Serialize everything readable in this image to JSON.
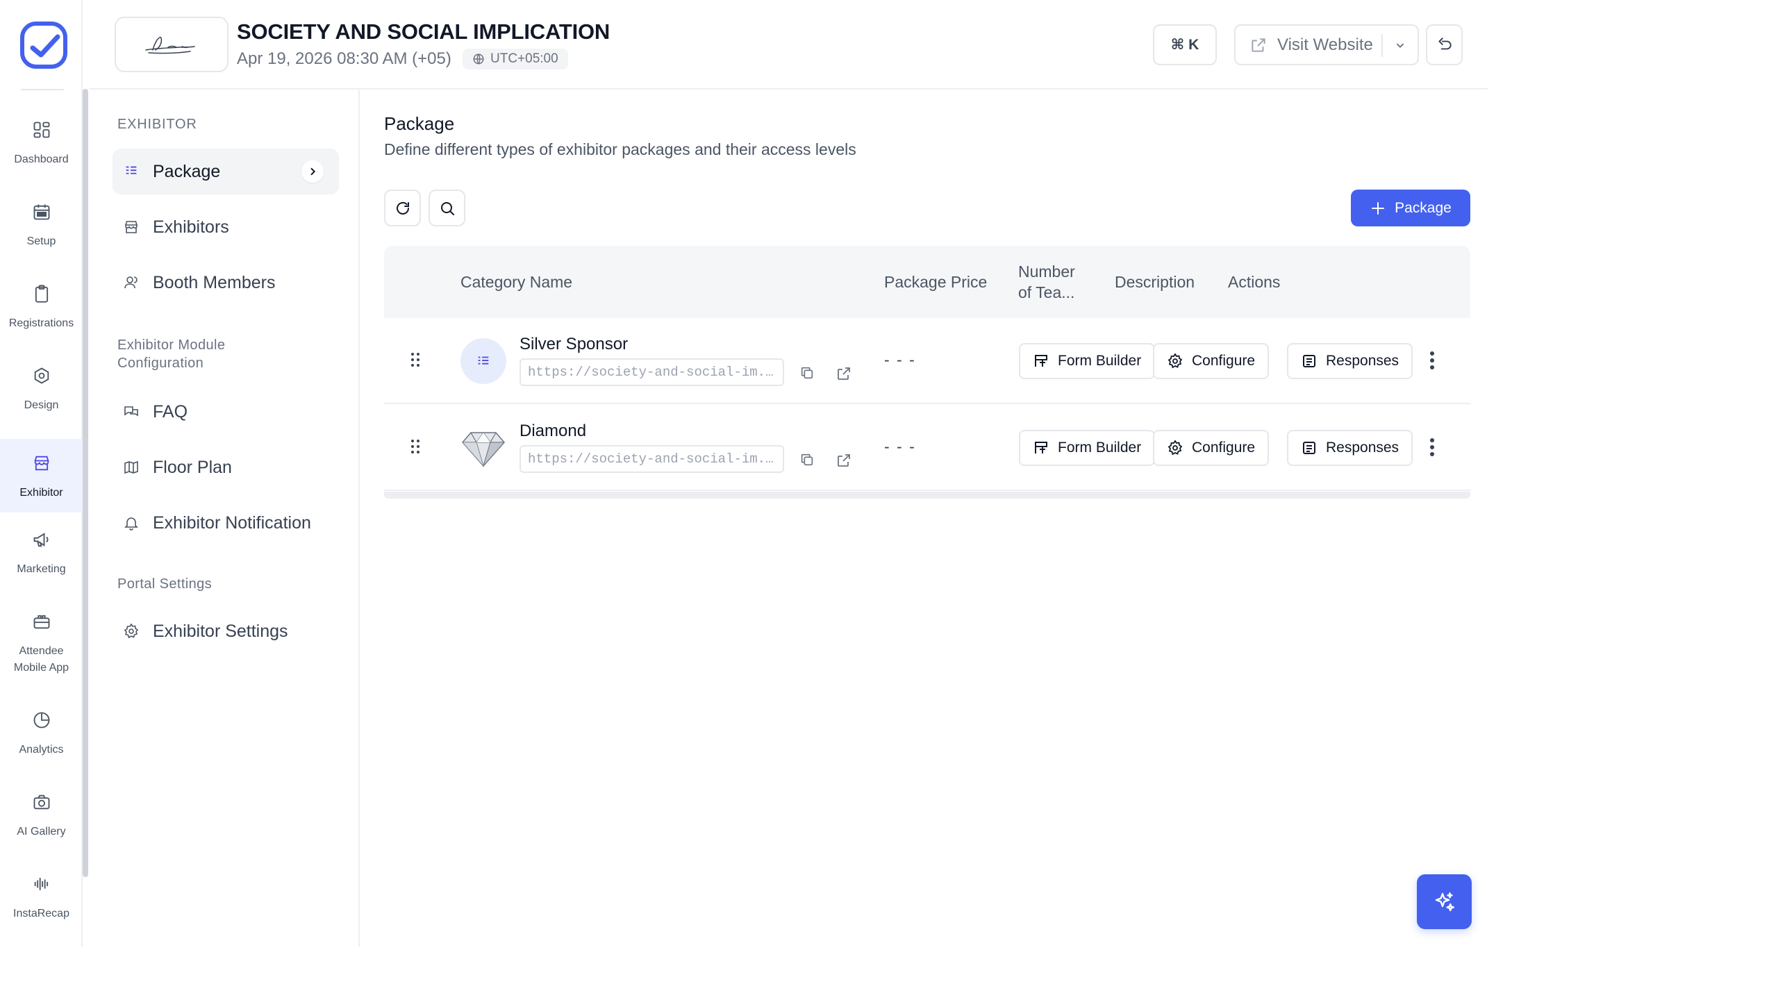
{
  "rail": {
    "items": [
      {
        "label": "Dashboard",
        "icon": "dashboard-icon"
      },
      {
        "label": "Setup",
        "icon": "calendar-icon"
      },
      {
        "label": "Registrations",
        "icon": "clipboard-icon"
      },
      {
        "label": "Design",
        "icon": "design-icon"
      },
      {
        "label": "Exhibitor",
        "icon": "store-icon"
      },
      {
        "label": "Marketing",
        "icon": "megaphone-icon"
      },
      {
        "label": "Attendee Mobile App",
        "icon": "mobile-app-icon"
      },
      {
        "label": "Analytics",
        "icon": "pie-chart-icon"
      },
      {
        "label": "AI Gallery",
        "icon": "camera-icon"
      },
      {
        "label": "InstaRecap",
        "icon": "soundwave-icon"
      }
    ],
    "active": "Exhibitor"
  },
  "header": {
    "title": "SOCIETY AND SOCIAL IMPLICATION",
    "datetime": "Apr 19, 2026 08:30 AM (+05)",
    "timezone": "UTC+05:00",
    "shortcut": "⌘ K",
    "visit_label": "Visit Website"
  },
  "subnav": {
    "section_exhibitor": "EXHIBITOR",
    "items_main": [
      {
        "label": "Package"
      },
      {
        "label": "Exhibitors"
      },
      {
        "label": "Booth Members"
      }
    ],
    "section_module": "Exhibitor Module Configuration",
    "items_module": [
      {
        "label": "FAQ"
      },
      {
        "label": "Floor Plan"
      },
      {
        "label": "Exhibitor Notification"
      }
    ],
    "section_portal": "Portal Settings",
    "items_portal": [
      {
        "label": "Exhibitor Settings"
      }
    ]
  },
  "main": {
    "title": "Package",
    "subtitle": "Define different types of exhibitor packages and their access levels",
    "add_label": "Package",
    "table": {
      "headers": {
        "category": "Category Name",
        "price": "Package Price",
        "team_line1": "Number",
        "team_line2": "of Tea...",
        "description": "Description",
        "actions": "Actions"
      },
      "rows": [
        {
          "name": "Silver Sponsor",
          "url": "https://society-and-social-im...",
          "price": "- - -"
        },
        {
          "name": "Diamond",
          "url": "https://society-and-social-im...",
          "price": "- - -"
        }
      ],
      "actions": {
        "form_builder": "Form Builder",
        "configure": "Configure",
        "responses": "Responses"
      }
    }
  },
  "colors": {
    "accent": "#4361ee",
    "active_bg": "#eef2ff"
  }
}
